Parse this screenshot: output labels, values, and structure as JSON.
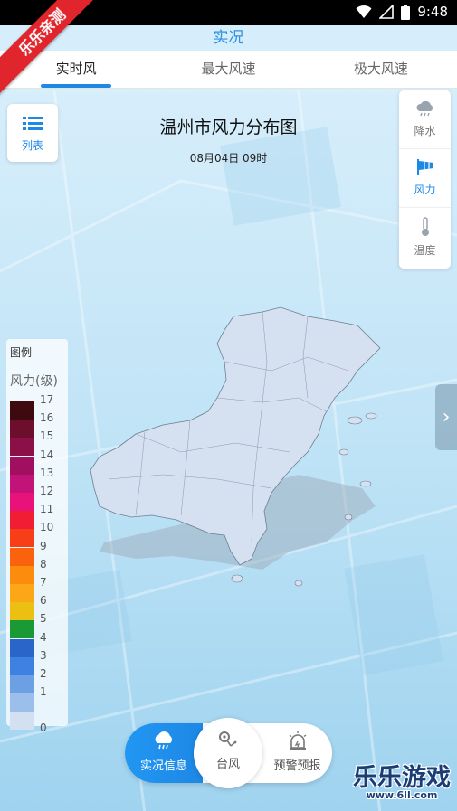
{
  "status_bar": {
    "time": "9:48"
  },
  "ribbon": {
    "text": "乐乐亲测"
  },
  "app": {
    "title": "实况"
  },
  "tabs": [
    {
      "label": "实时风",
      "active": true
    },
    {
      "label": "最大风速",
      "active": false
    },
    {
      "label": "极大风速",
      "active": false
    }
  ],
  "list_button": {
    "label": "列表",
    "icon": "list-icon"
  },
  "map": {
    "title": "温州市风力分布图",
    "datetime": "08月04日 09时"
  },
  "layers": [
    {
      "label": "降水",
      "icon": "rain-cloud-icon",
      "active": false
    },
    {
      "label": "风力",
      "icon": "wind-flag-icon",
      "active": true
    },
    {
      "label": "温度",
      "icon": "thermometer-icon",
      "active": false
    }
  ],
  "side_tab": {
    "icon": "chevron-right-icon"
  },
  "legend": {
    "title": "图例",
    "unit": "风力(级)",
    "levels": [
      {
        "value": "17",
        "color": "#3d0a0f"
      },
      {
        "value": "16",
        "color": "#6d0f2c"
      },
      {
        "value": "15",
        "color": "#8c1048"
      },
      {
        "value": "14",
        "color": "#a10f60"
      },
      {
        "value": "13",
        "color": "#c21378"
      },
      {
        "value": "12",
        "color": "#e8127a"
      },
      {
        "value": "11",
        "color": "#f01d35"
      },
      {
        "value": "10",
        "color": "#f73e16"
      },
      {
        "value": "9",
        "color": "#fa620e"
      },
      {
        "value": "8",
        "color": "#fc8c0e"
      },
      {
        "value": "7",
        "color": "#fca717"
      },
      {
        "value": "6",
        "color": "#ecc012"
      },
      {
        "value": "5",
        "color": "#1a9a35"
      },
      {
        "value": "4",
        "color": "#2a66c9"
      },
      {
        "value": "3",
        "color": "#3e81e0"
      },
      {
        "value": "2",
        "color": "#6c9fe3"
      },
      {
        "value": "1",
        "color": "#9cbeea"
      },
      {
        "value": "0",
        "color": "#d2e0f2"
      }
    ]
  },
  "bottom_nav": [
    {
      "label": "实况信息",
      "icon": "rain-cloud-icon",
      "active": true
    },
    {
      "label": "台风",
      "icon": "typhoon-icon",
      "active": false
    },
    {
      "label": "预警预报",
      "icon": "warning-light-icon",
      "active": false
    }
  ],
  "watermark": {
    "text": "乐乐游戏",
    "sub": "www.6ll.com"
  }
}
